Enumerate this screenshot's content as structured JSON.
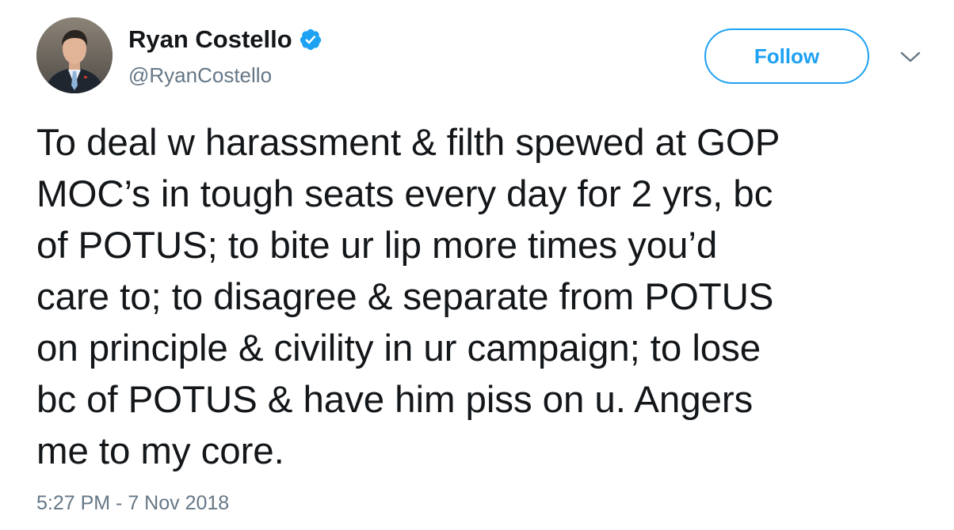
{
  "user": {
    "display_name": "Ryan Costello",
    "handle": "@RyanCostello",
    "verified": true,
    "avatar_icon": "profile-photo-avatar"
  },
  "actions": {
    "follow_label": "Follow",
    "more_icon": "chevron-down-icon"
  },
  "tweet": {
    "text": "To deal w harassment & filth spewed at GOP\nMOC’s in tough seats every day for 2 yrs, bc\nof POTUS; to bite ur lip more times you’d\ncare to; to disagree & separate from POTUS\non principle & civility in ur campaign; to lose\nbc of POTUS & have him piss on u. Angers\nme to my core.",
    "timestamp": "5:27 PM - 7 Nov 2018"
  },
  "colors": {
    "accent": "#1da1f2",
    "text": "#14171a",
    "secondary_text": "#657786"
  }
}
